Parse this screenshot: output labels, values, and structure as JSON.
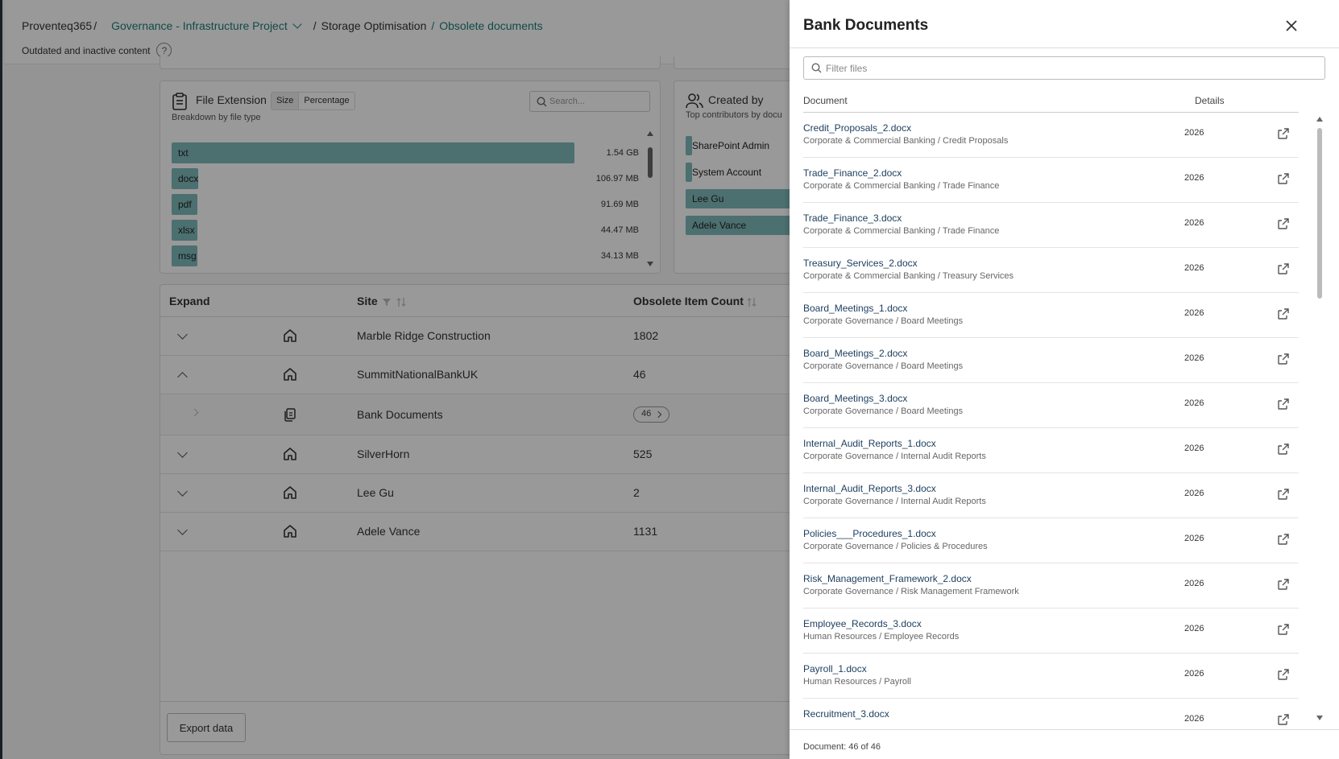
{
  "breadcrumb": {
    "root": "Proventeq365",
    "project": "Governance - Infrastructure Project",
    "section": "Storage Optimisation",
    "page": "Obsolete documents",
    "subtitle": "Outdated and inactive content",
    "help": "?"
  },
  "file_extension": {
    "title": "File Extension",
    "subtitle": "Breakdown by file type",
    "toggle_size": "Size",
    "toggle_percentage": "Percentage",
    "search_placeholder": "Search...",
    "rows": [
      {
        "label": "txt",
        "value": "1.54 GB",
        "fraction": 1.0
      },
      {
        "label": "docx",
        "value": "106.97 MB",
        "fraction": 0.066
      },
      {
        "label": "pdf",
        "value": "91.69 MB",
        "fraction": 0.057
      },
      {
        "label": "xlsx",
        "value": "44.47 MB",
        "fraction": 0.028
      },
      {
        "label": "msg",
        "value": "34.13 MB",
        "fraction": 0.021
      }
    ]
  },
  "created_by": {
    "title": "Created by",
    "subtitle": "Top contributors by docu",
    "rows": [
      {
        "label": "SharePoint Admin",
        "fraction": 0.02
      },
      {
        "label": "System Account",
        "fraction": 0.02
      },
      {
        "label": "Lee Gu",
        "fraction": 1.0
      },
      {
        "label": "Adele Vance",
        "fraction": 1.0
      }
    ]
  },
  "table": {
    "headers": {
      "expand": "Expand",
      "site": "Site",
      "count": "Obsolete Item Count"
    },
    "rows": [
      {
        "site": "Marble Ridge Construction",
        "count": "1802",
        "expanded": false
      },
      {
        "site": "SummitNationalBankUK",
        "count": "46",
        "expanded": true
      },
      {
        "site": "SilverHorn",
        "count": "525",
        "expanded": false
      },
      {
        "site": "Lee Gu",
        "count": "2",
        "expanded": false
      },
      {
        "site": "Adele Vance",
        "count": "1131",
        "expanded": false
      }
    ],
    "subrow": {
      "label": "Bank Documents",
      "badge": "46"
    },
    "export_label": "Export data"
  },
  "panel": {
    "title": "Bank Documents",
    "filter_placeholder": "Filter files",
    "col_document": "Document",
    "col_details": "Details",
    "footer": "Document: 46 of 46",
    "docs": [
      {
        "name": "Credit_Proposals_2.docx",
        "path": "Corporate & Commercial Banking / Credit Proposals",
        "year": "2026"
      },
      {
        "name": "Trade_Finance_2.docx",
        "path": "Corporate & Commercial Banking / Trade Finance",
        "year": "2026"
      },
      {
        "name": "Trade_Finance_3.docx",
        "path": "Corporate & Commercial Banking / Trade Finance",
        "year": "2026"
      },
      {
        "name": "Treasury_Services_2.docx",
        "path": "Corporate & Commercial Banking / Treasury Services",
        "year": "2026"
      },
      {
        "name": "Board_Meetings_1.docx",
        "path": "Corporate Governance / Board Meetings",
        "year": "2026"
      },
      {
        "name": "Board_Meetings_2.docx",
        "path": "Corporate Governance / Board Meetings",
        "year": "2026"
      },
      {
        "name": "Board_Meetings_3.docx",
        "path": "Corporate Governance / Board Meetings",
        "year": "2026"
      },
      {
        "name": "Internal_Audit_Reports_1.docx",
        "path": "Corporate Governance / Internal Audit Reports",
        "year": "2026"
      },
      {
        "name": "Internal_Audit_Reports_3.docx",
        "path": "Corporate Governance / Internal Audit Reports",
        "year": "2026"
      },
      {
        "name": "Policies___Procedures_1.docx",
        "path": "Corporate Governance / Policies & Procedures",
        "year": "2026"
      },
      {
        "name": "Risk_Management_Framework_2.docx",
        "path": "Corporate Governance / Risk Management Framework",
        "year": "2026"
      },
      {
        "name": "Employee_Records_3.docx",
        "path": "Human Resources / Employee Records",
        "year": "2026"
      },
      {
        "name": "Payroll_1.docx",
        "path": "Human Resources / Payroll",
        "year": "2026"
      },
      {
        "name": "Recruitment_3.docx",
        "path": "",
        "year": "2026"
      }
    ]
  }
}
